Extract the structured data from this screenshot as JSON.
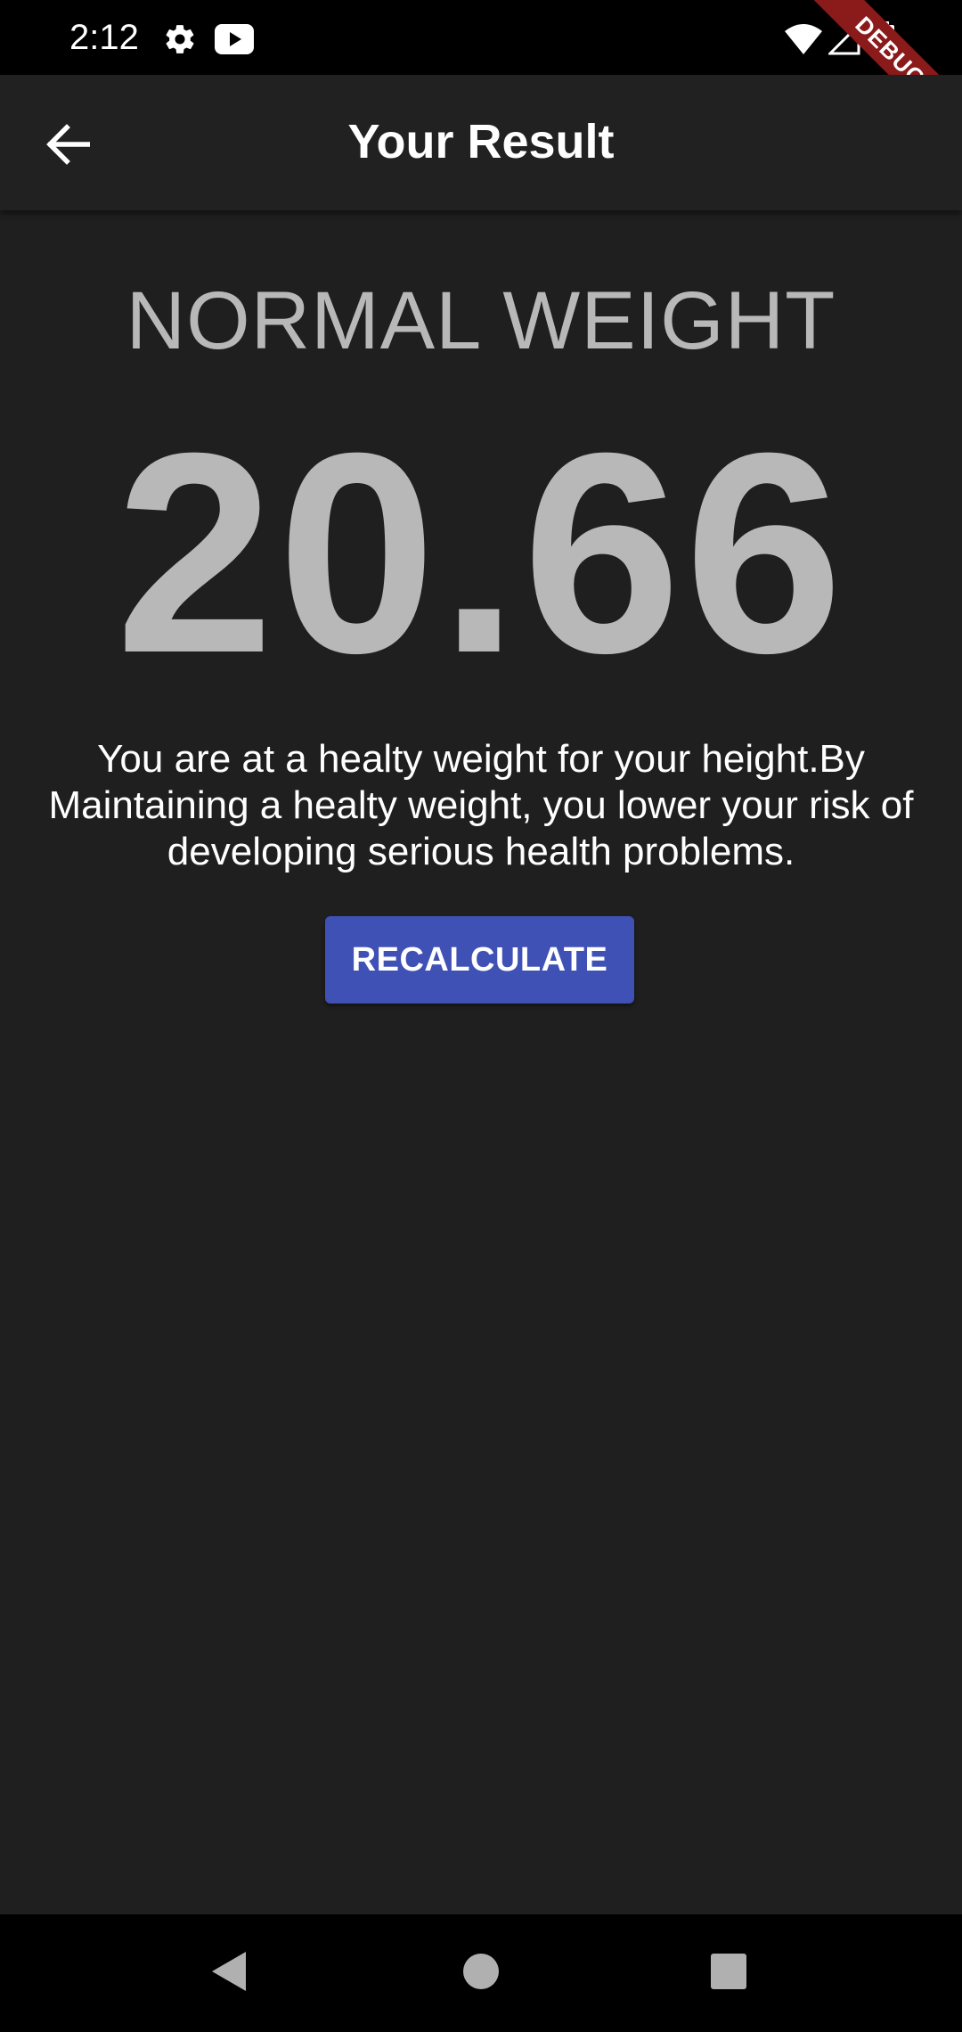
{
  "status_bar": {
    "time": "2:12",
    "icons": [
      "gear-icon",
      "youtube-icon",
      "wifi-icon",
      "signal-icon",
      "battery-icon"
    ]
  },
  "debug_ribbon": {
    "label": "DEBUG"
  },
  "app_bar": {
    "title": "Your Result",
    "back_icon": "arrow-back-icon"
  },
  "result": {
    "category": "NORMAL WEIGHT",
    "bmi": "20.66",
    "interpretation": "You are at a healty weight for your height.By Maintaining a healty weight, you lower your risk of developing serious health problems."
  },
  "actions": {
    "recalculate_label": "RECALCULATE"
  },
  "nav_bar": {
    "icons": [
      "back-triangle-icon",
      "home-circle-icon",
      "recents-square-icon"
    ]
  },
  "colors": {
    "background": "#1f1f1f",
    "app_bar": "#212121",
    "accent": "#3f51b5",
    "result_text": "#b8b8b8",
    "debug_ribbon": "#8b1a1a"
  }
}
